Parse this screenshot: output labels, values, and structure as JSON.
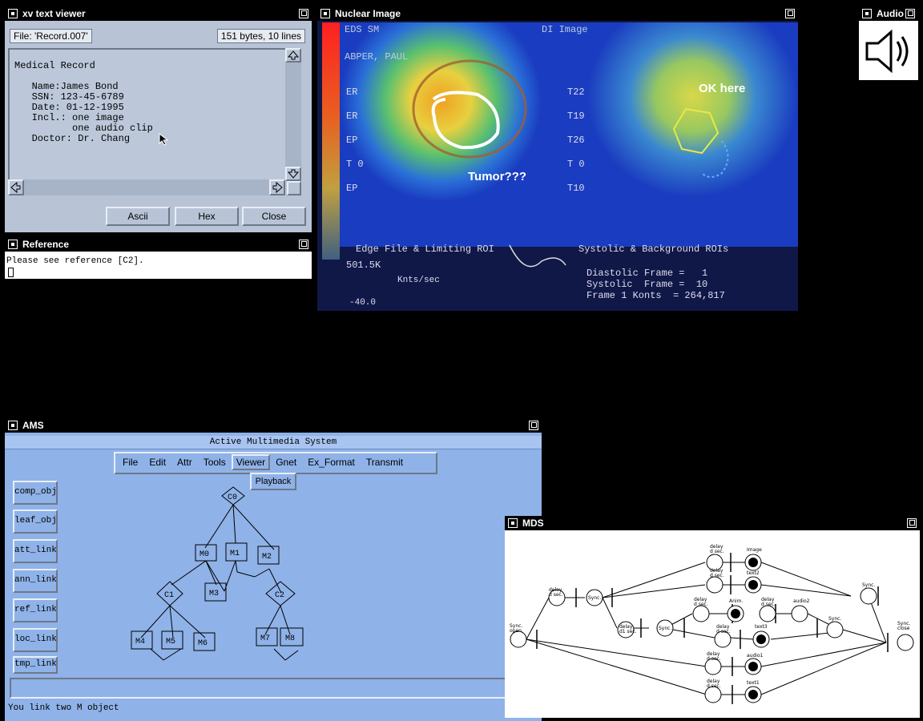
{
  "text_viewer": {
    "title": "xv text viewer",
    "file_label": "File: 'Record.007'",
    "info_label": "151 bytes, 10 lines",
    "lines": [
      "Medical Record",
      "",
      "   Name:James Bond",
      "   SSN: 123-45-6789",
      "   Date: 01-12-1995",
      "   Incl.: one image",
      "          one audio clip",
      "   Doctor: Dr. Chang"
    ],
    "buttons": {
      "ascii": "Ascii",
      "hex": "Hex",
      "close": "Close"
    }
  },
  "reference": {
    "title": "Reference",
    "text": "Please see reference [C2]."
  },
  "nuclear": {
    "title": "Nuclear Image",
    "annotation_left": "Tumor???",
    "annotation_right": "OK here",
    "side_labels_left": [
      "ER",
      "ER",
      "EP",
      "T 0",
      "EP"
    ],
    "side_labels_right": [
      "T22",
      "T19",
      "T26",
      "T 0",
      "T10"
    ],
    "header_left": "EDS SM",
    "header_left2": "ABPER, PAUL",
    "header_right": "DI Image",
    "caption_left": "Edge File & Limiting ROI",
    "caption_right": "Systolic & Background ROIs",
    "stat_1": "Diastolic Frame =   1",
    "stat_2": "Systolic  Frame =  10",
    "stat_3": "Frame 1 Konts  = 264,817",
    "graph_value": "501.5K",
    "graph_label": "Knts/sec",
    "graph_bottom": "-40.0"
  },
  "audio": {
    "title": "Audio"
  },
  "ams": {
    "title": "AMS",
    "header": "Active Multimedia System",
    "menu": [
      "File",
      "Edit",
      "Attr",
      "Tools",
      "Viewer",
      "Gnet",
      "Ex_Format",
      "Transmit"
    ],
    "dropdown_item": "Playback",
    "side_buttons": [
      "comp_obj",
      "leaf_obj",
      "att_link",
      "ann_link",
      "ref_link",
      "loc_link",
      "tmp_link"
    ],
    "nodes": {
      "c0": "C0",
      "m0": "M0",
      "m1": "M1",
      "m2": "M2",
      "c1": "C1",
      "m3": "M3",
      "c2": "C2",
      "m4": "M4",
      "m5": "M5",
      "m6": "M6",
      "m7": "M7",
      "m8": "M8"
    },
    "status": "You link two M object"
  },
  "mds": {
    "title": "MDS",
    "labels": {
      "sync_open": "Sync.\nopen",
      "delay_dsec1": "delay\nd sec.",
      "sync1": "Sync.",
      "delay_d1sec": "delay\nd1 sec.",
      "image": "Image",
      "delay_d2sec": "delay\nd sec.",
      "text2": "text2",
      "delay_a": "delay\nd sec.",
      "anim": "Anim.",
      "delay_b": "delay\nd sec.",
      "audio2": "audio2",
      "delay_c": "delay\nd sec.",
      "sync2": "Sync.",
      "delay_d": "delay\nd sec.",
      "text3": "text3",
      "sync3": "Sync.",
      "sync4": "Sync.",
      "delay_e": "delay\nd sec.",
      "audio1": "audio1",
      "delay_f": "delay\nd sec.",
      "text1": "text1",
      "sync_close": "Sync.\nclose"
    }
  }
}
